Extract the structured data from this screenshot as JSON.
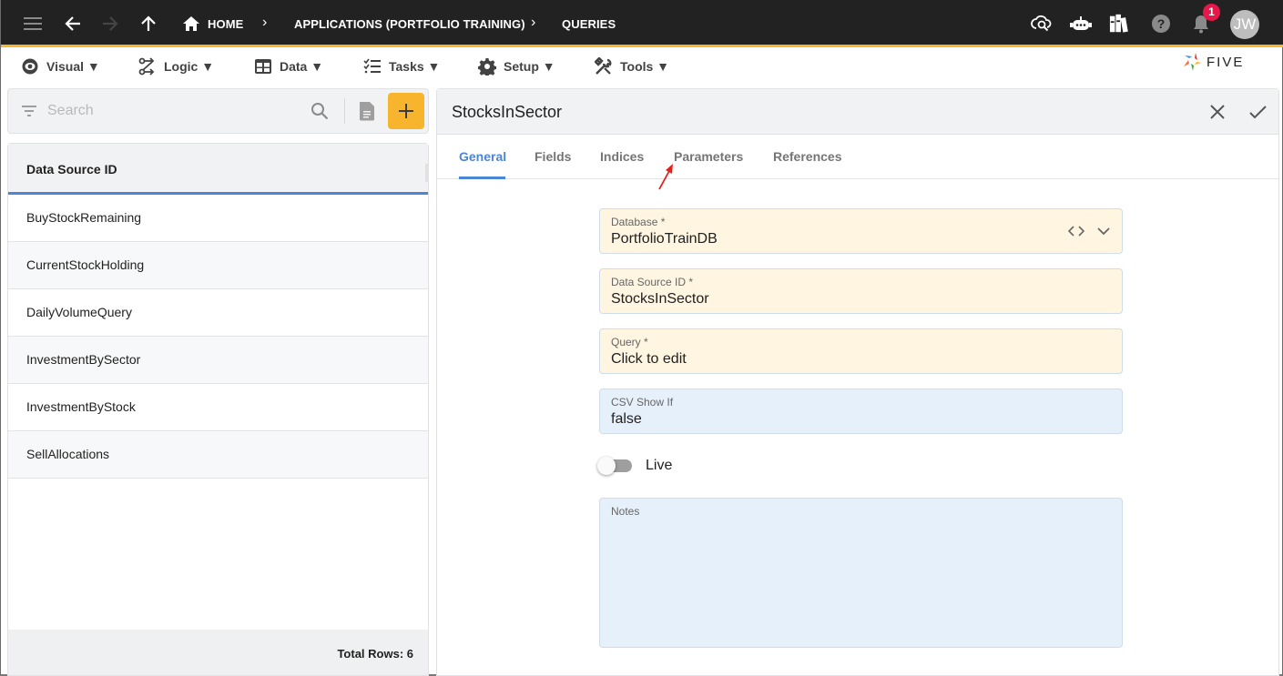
{
  "appbar": {
    "breadcrumbs": [
      {
        "label": "HOME",
        "icon": "home-icon"
      },
      {
        "label": "APPLICATIONS (PORTFOLIO TRAINING)"
      },
      {
        "label": "QUERIES"
      }
    ],
    "notifications_count": "1",
    "avatar_initials": "JW",
    "icons": [
      "menu-icon",
      "back-arrow-icon",
      "forward-arrow-icon",
      "up-arrow-icon",
      "cloud-search-icon",
      "chatbot-icon",
      "library-icon",
      "help-icon",
      "bell-icon"
    ]
  },
  "menubar": {
    "items": [
      {
        "label": "Visual ▼",
        "icon": "eye-icon"
      },
      {
        "label": "Logic ▼",
        "icon": "logic-icon"
      },
      {
        "label": "Data ▼",
        "icon": "table-icon"
      },
      {
        "label": "Tasks ▼",
        "icon": "checklist-icon"
      },
      {
        "label": "Setup ▼",
        "icon": "gear-icon"
      },
      {
        "label": "Tools ▼",
        "icon": "tools-icon"
      }
    ],
    "logo_text": "FIVE"
  },
  "list": {
    "search_placeholder": "Search",
    "search_value": "",
    "column_header": "Data Source ID",
    "rows": [
      "BuyStockRemaining",
      "CurrentStockHolding",
      "DailyVolumeQuery",
      "InvestmentBySector",
      "InvestmentByStock",
      "SellAllocations"
    ],
    "footer": "Total Rows: 6"
  },
  "form": {
    "title": "StocksInSector",
    "tabs": [
      "General",
      "Fields",
      "Indices",
      "Parameters",
      "References"
    ],
    "active_tab": "General",
    "fields": {
      "database": {
        "label": "Database *",
        "value": "PortfolioTrainDB"
      },
      "data_source_id": {
        "label": "Data Source ID *",
        "value": "StocksInSector"
      },
      "query": {
        "label": "Query *",
        "value": "Click to edit"
      },
      "csv_show_if": {
        "label": "CSV Show If",
        "value": "false"
      },
      "live": {
        "label": "Live",
        "checked": false
      },
      "notes": {
        "label": "Notes",
        "value": ""
      }
    }
  },
  "colors": {
    "accent_yellow": "#f6b52c",
    "accent_blue": "#4a86d4",
    "required_field_bg": "#fff5e1",
    "optional_field_bg": "#e6f0fa",
    "notification_red": "#e8174a"
  }
}
